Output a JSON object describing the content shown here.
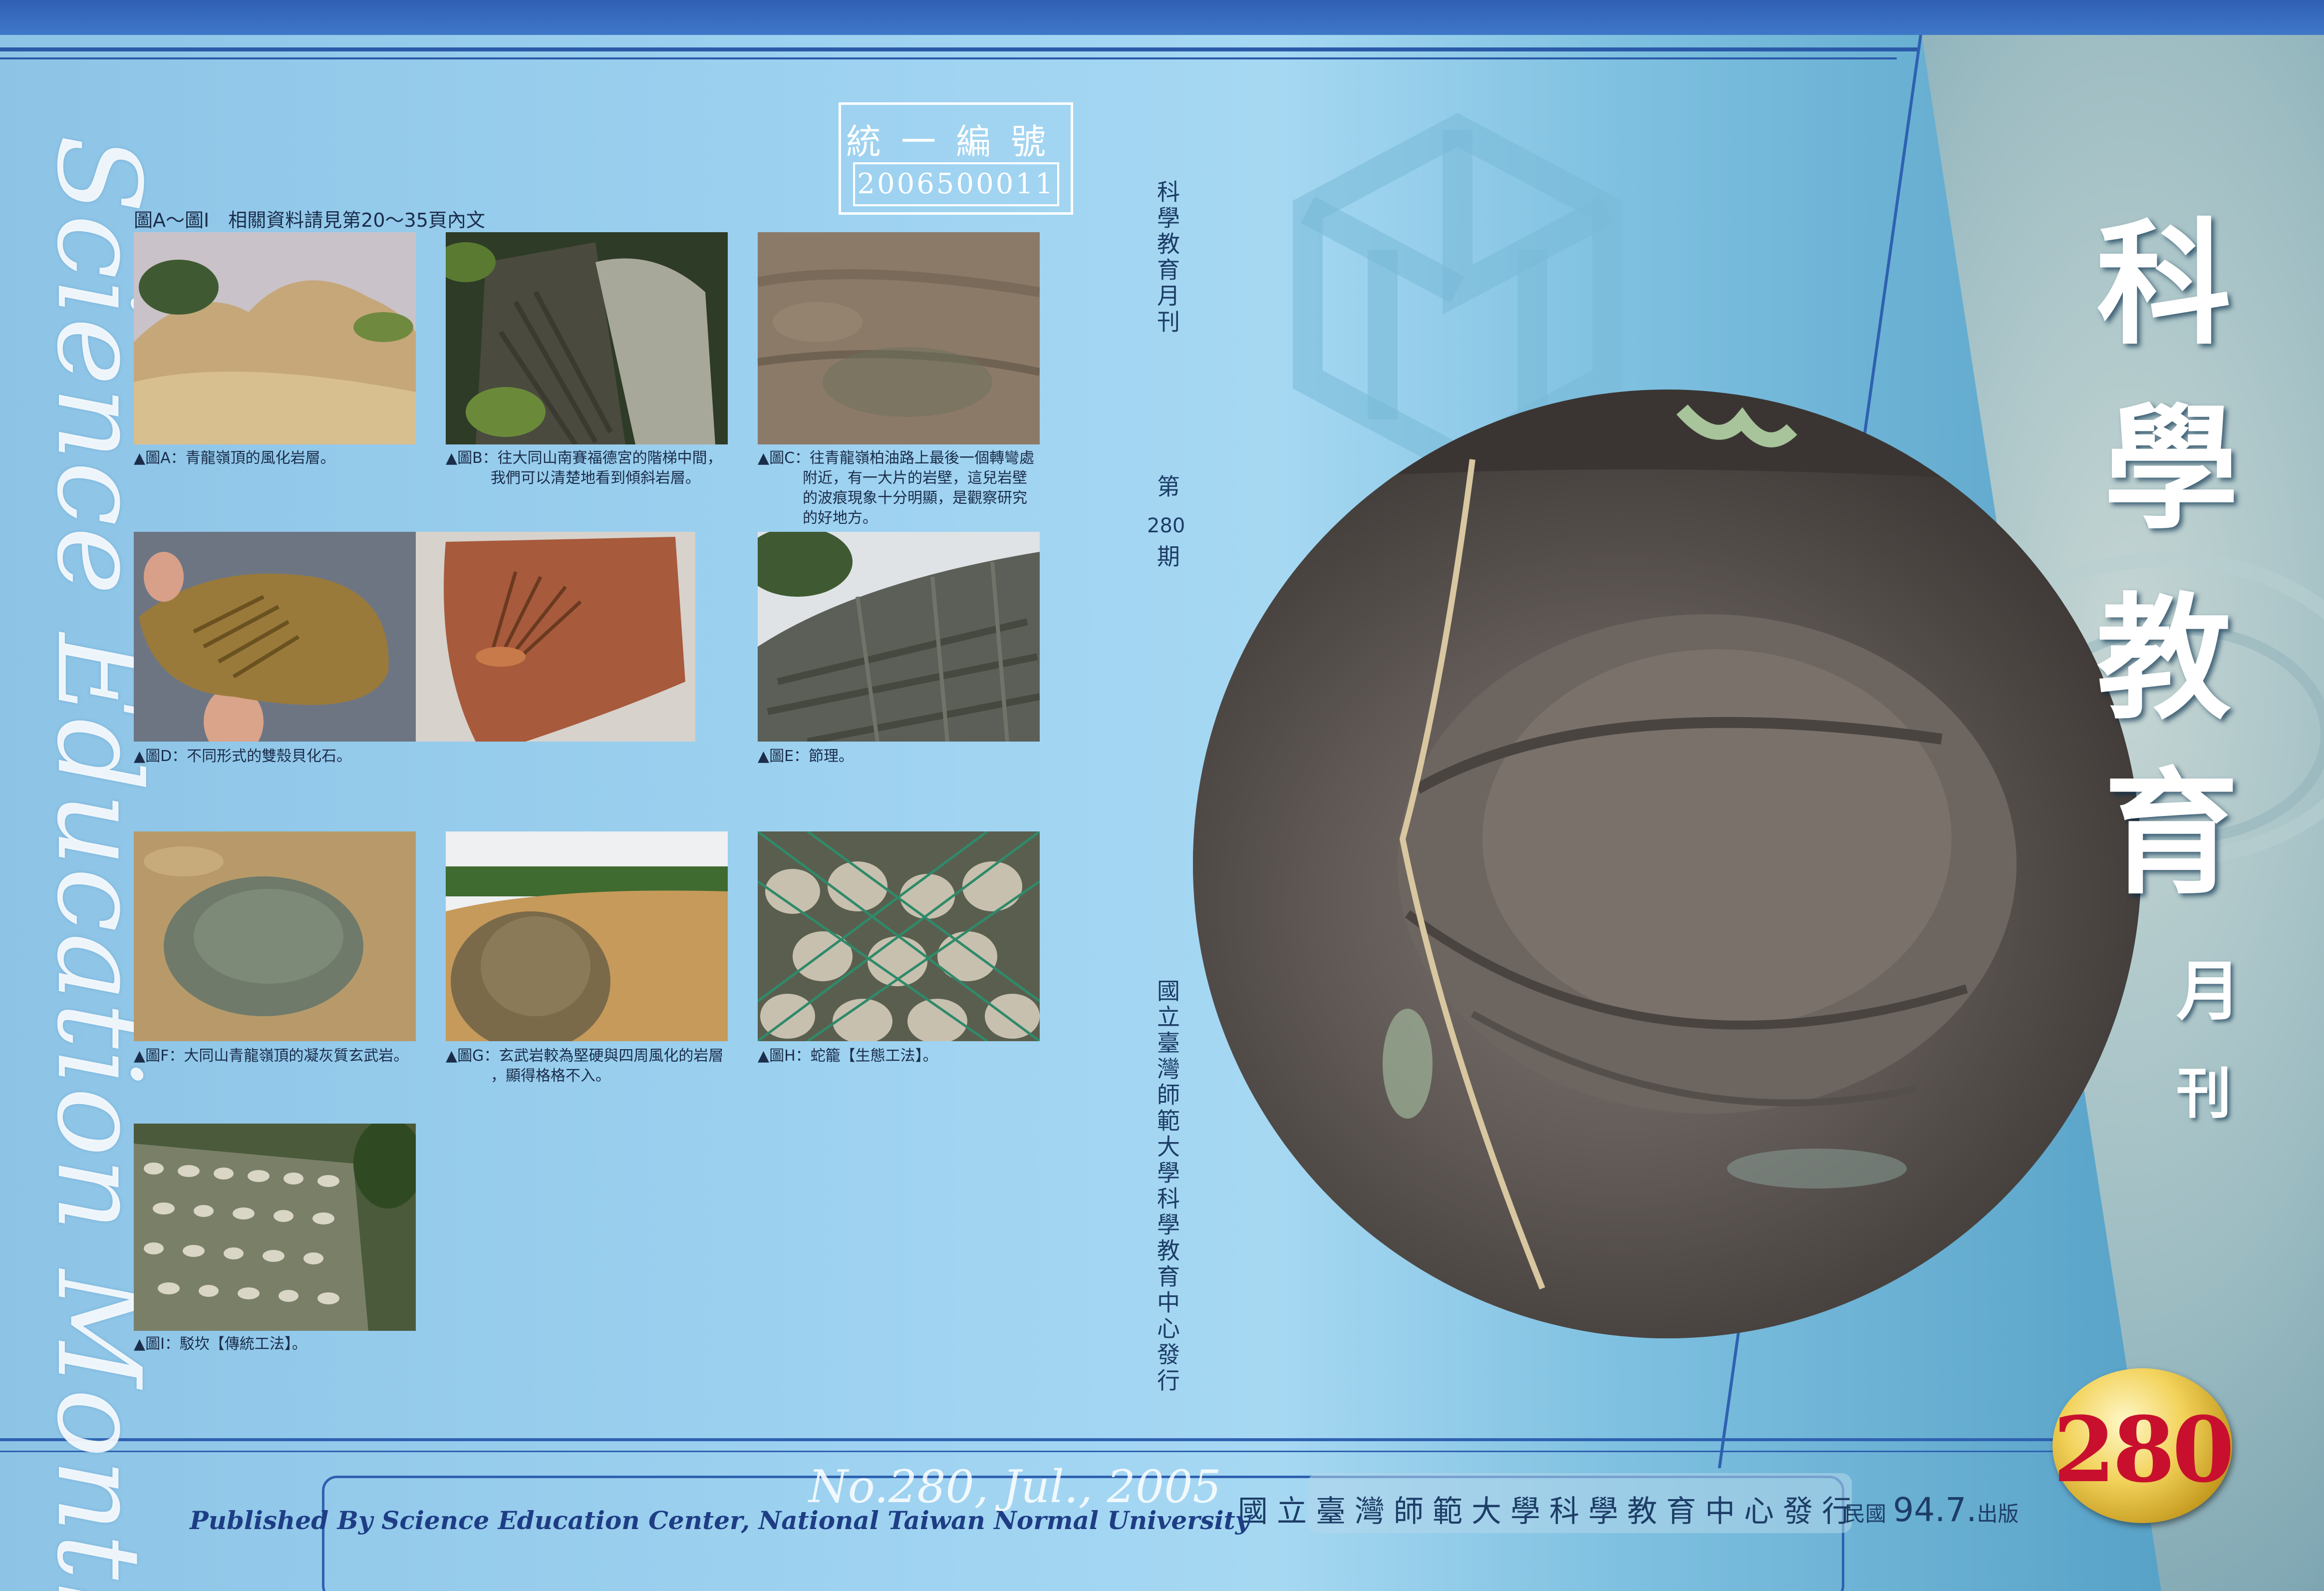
{
  "back_cover": {
    "english_title": "Science Education Monthly",
    "registration_label": "統一編號",
    "registration_number": "2006500011",
    "figures_header": "圖A～圖I　相關資料請見第20～35頁內文",
    "captions": {
      "a": "▲圖A：青龍嶺頂的風化岩層。",
      "b": "▲圖B：往大同山南賽福德宮的階梯中間，\n　　　我們可以清楚地看到傾斜岩層。",
      "c": "▲圖C：往青龍嶺柏油路上最後一個轉彎處\n　　　附近，有一大片的岩壁，這兒岩壁\n　　　的波痕現象十分明顯，是觀察研究\n　　　的好地方。",
      "d": "▲圖D：不同形式的雙殼貝化石。",
      "e": "▲圖E：節理。",
      "f": "▲圖F：大同山青龍嶺頂的凝灰質玄武岩。",
      "g": "▲圖G：玄武岩較為堅硬與四周風化的岩層\n　　　，顯得格格不入。",
      "h": "▲圖H：蛇籠【生態工法】。",
      "i": "▲圖I：駁坎【傳統工法】。"
    },
    "issue_line": "No.280, Jul., 2005",
    "published_by": "Published By Science Education Center, National Taiwan Normal University"
  },
  "spine": {
    "title": "科學教育月刊",
    "issue_prefix": "第",
    "issue_number": "280",
    "issue_suffix": "期",
    "publisher": "國立臺灣師範大學科學教育中心發行"
  },
  "front_cover": {
    "title_chars": [
      "科",
      "學",
      "教",
      "育"
    ],
    "subtitle_chars": [
      "月",
      "刊"
    ],
    "issue_badge": "280",
    "publisher": "國立臺灣師範大學科學教育中心發行",
    "date_prefix": "民國",
    "date_value": "94.7.",
    "date_suffix": "出版"
  }
}
